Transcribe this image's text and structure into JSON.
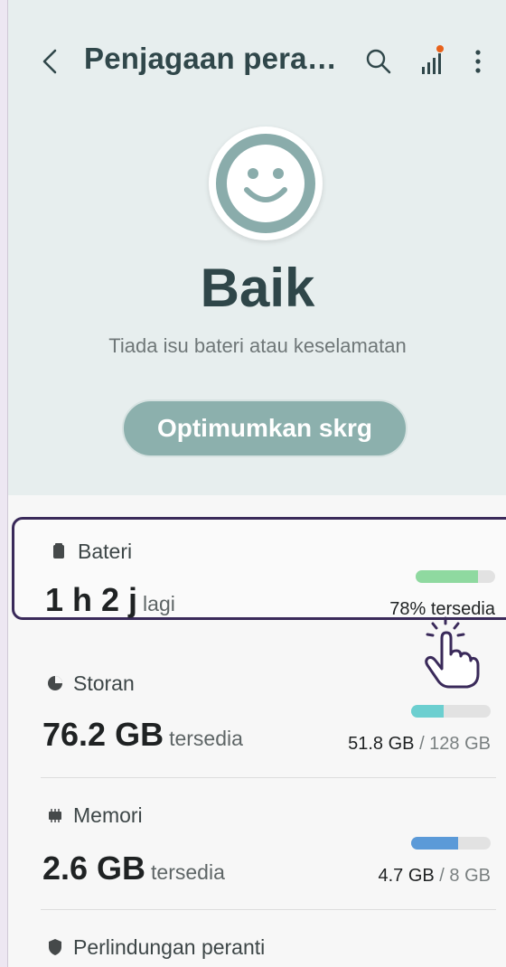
{
  "header": {
    "title": "Penjagaan pera…",
    "back_icon": "back-arrow-icon",
    "search_icon": "search-icon",
    "signal_icon": "signal-bars-icon",
    "more_icon": "more-vertical-icon"
  },
  "status": {
    "face_icon": "smiley-face-icon",
    "label": "Baik",
    "subtitle": "Tiada isu bateri atau keselamatan",
    "button_label": "Optimumkan skrg"
  },
  "battery": {
    "label": "Bateri",
    "value": "1 h 2 j",
    "unit": "lagi",
    "percent_text": "78% tersedia",
    "level": 0.78,
    "bar_color": "#8fd9a0"
  },
  "storage": {
    "label": "Storan",
    "value": "76.2 GB",
    "unit": "tersedia",
    "used": "51.8 GB",
    "total": "/ 128 GB",
    "level": 0.405,
    "bar_color": "#6ccfd0"
  },
  "memory": {
    "label": "Memori",
    "value": "2.6 GB",
    "unit": "tersedia",
    "used": "4.7 GB",
    "total": "/ 8 GB",
    "level": 0.59,
    "bar_color": "#5b9ad8"
  },
  "protection": {
    "label": "Perlindungan peranti"
  },
  "colors": {
    "header_bg": "#e7eeee",
    "accent": "#8cb0ad",
    "highlight_border": "#3a2a5a"
  }
}
